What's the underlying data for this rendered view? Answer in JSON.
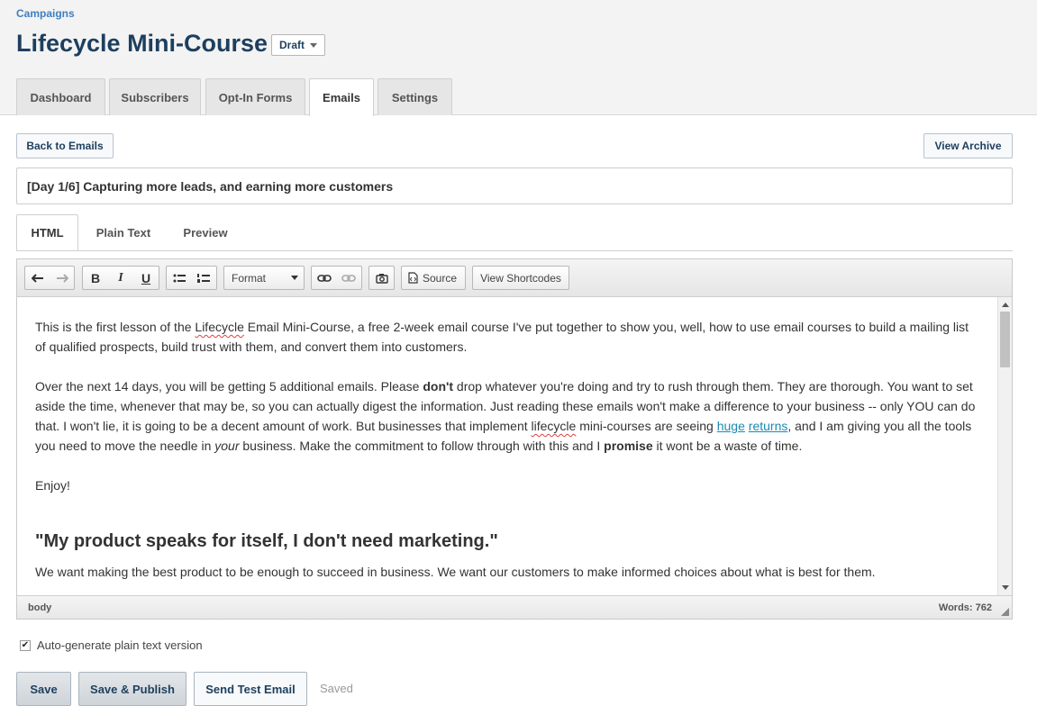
{
  "breadcrumb": "Campaigns",
  "title": "Lifecycle Mini-Course",
  "status": "Draft",
  "tabs": [
    "Dashboard",
    "Subscribers",
    "Opt-In Forms",
    "Emails",
    "Settings"
  ],
  "active_tab": "Emails",
  "buttons": {
    "back": "Back to Emails",
    "archive": "View Archive"
  },
  "subject": "[Day 1/6] Capturing more leads, and earning more customers",
  "editor_tabs": [
    "HTML",
    "Plain Text",
    "Preview"
  ],
  "toolbar": {
    "format": "Format",
    "source": "Source",
    "shortcodes": "View Shortcodes"
  },
  "content": {
    "p1a": "This is the first lesson of the ",
    "p1_spell": "Lifecycle",
    "p1b": " Email Mini-Course, a free 2-week email course I've put together to show you, well, how to use email courses to build a mailing list of qualified prospects, build trust with them, and convert them into customers.",
    "p2a": "Over the next 14 days, you will be getting 5 additional emails.  Please ",
    "p2_bold1": "don't",
    "p2b": " drop whatever you're doing and try to rush through them.  They are thorough.  You want to set aside the time, whenever that may be, so you can actually digest the information.  Just reading these emails won't make a difference to your business -- only YOU can do that.  I won't lie, it is going to be a decent amount of work.  But businesses that implement ",
    "p2_spell": "lifecycle",
    "p2c": " mini-courses are seeing ",
    "p2_link1": "huge",
    "p2_link2": "returns",
    "p2d": ", and I am giving you all the tools you need to move the needle in ",
    "p2_italic": "your",
    "p2e": " business.  Make the commitment to follow through with this and I ",
    "p2_bold2": "promise",
    "p2f": " it wont be a waste of time.",
    "p3": "Enjoy!",
    "heading": "\"My product speaks for itself, I don't need marketing.\"",
    "p4": "We want making the best product to be enough to succeed in business.  We want our customers to make informed choices about what is best for them."
  },
  "statusbar": {
    "path": "body",
    "words": "Words: 762"
  },
  "auto_generate": {
    "label": "Auto-generate plain text version",
    "checked": true
  },
  "actions": {
    "save": "Save",
    "publish": "Save & Publish",
    "test": "Send Test Email",
    "saved": "Saved"
  }
}
